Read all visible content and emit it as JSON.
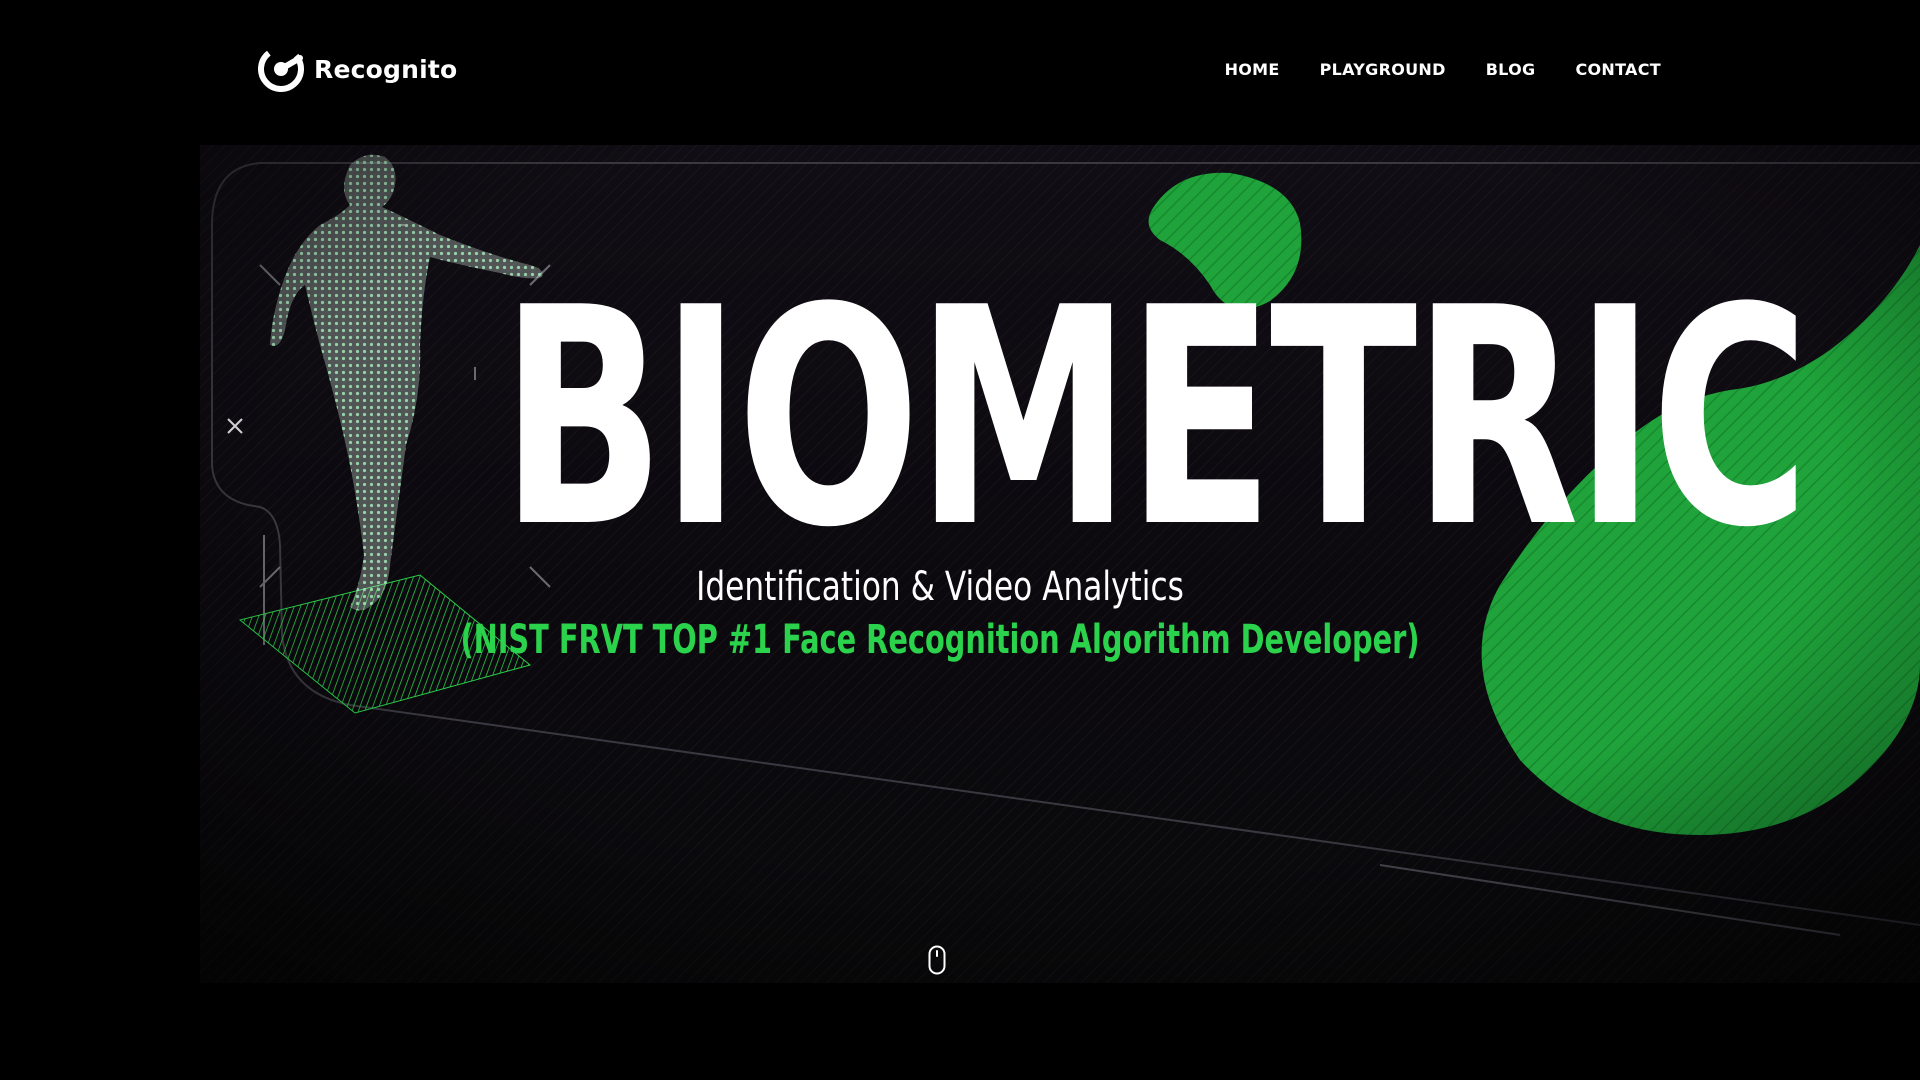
{
  "header": {
    "logo_text": "Recognito",
    "logo_icon": "recognito-logo-icon",
    "nav": [
      {
        "label": "HOME"
      },
      {
        "label": "PLAYGROUND"
      },
      {
        "label": "BLOG"
      },
      {
        "label": "CONTACT"
      }
    ]
  },
  "hero": {
    "headline": "BIOMETRIC",
    "subtitle": "Identification & Video Analytics",
    "tagline": "(NIST FRVT TOP #1 Face Recognition Algorithm Developer)",
    "scroll_icon": "mouse-scroll-icon",
    "close_icon": "close-icon"
  },
  "colors": {
    "background": "#000000",
    "accent_green": "#2bd24b",
    "blob_green": "#1fa33a",
    "text": "#ffffff"
  }
}
